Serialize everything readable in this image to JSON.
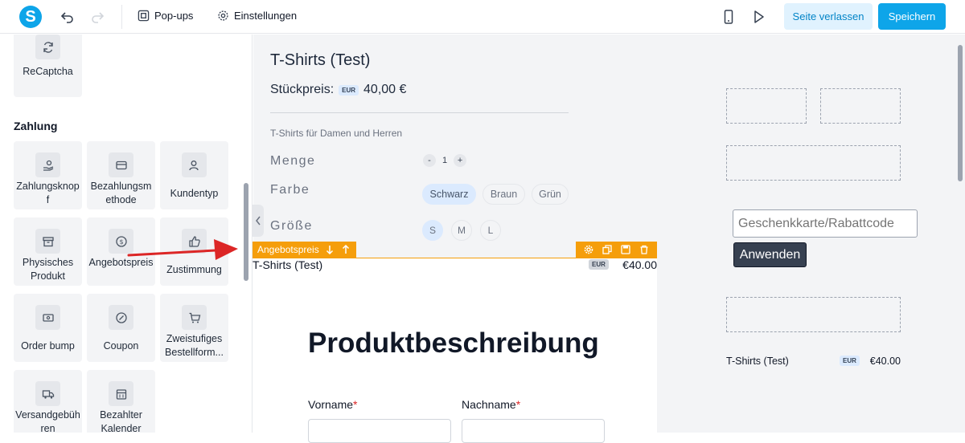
{
  "topbar": {
    "logo_letter": "S",
    "popups_label": "Pop-ups",
    "settings_label": "Einstellungen",
    "leave_label": "Seite verlassen",
    "save_label": "Speichern"
  },
  "sidebar": {
    "recaptcha_label": "ReCaptcha",
    "section_title": "Zahlung",
    "tiles": {
      "t1": "Zahlungsknopf",
      "t2": "Bezahlungsmethode",
      "t3": "Kundentyp",
      "t4": "Physisches Produkt",
      "t5": "Angebotspreis",
      "t6": "Zustimmung",
      "t7": "Order bump",
      "t8": "Coupon",
      "t9": "Zweistufiges Bestellform...",
      "t10": "Versandgebühren",
      "t11": "Bezahlter Kalender"
    }
  },
  "product": {
    "title": "T-Shirts (Test)",
    "price_label": "Stückpreis:",
    "currency_badge": "EUR",
    "price": "40,00 €",
    "description": "T-Shirts für Damen und Herren",
    "qty_label": "Menge",
    "qty_minus": "-",
    "qty_value": "1",
    "qty_plus": "+",
    "color_label": "Farbe",
    "colors": [
      "Schwarz",
      "Braun",
      "Grün"
    ],
    "size_label": "Größe",
    "sizes": [
      "S",
      "M",
      "L"
    ]
  },
  "selected_element": {
    "label": "Angebotspreis",
    "name": "T-Shirts (Test)",
    "currency_badge": "EUR",
    "price": "€40.00"
  },
  "form": {
    "heading": "Produktbeschreibung",
    "firstname_label": "Vorname",
    "lastname_label": "Nachname",
    "required_mark": "*"
  },
  "right_panel": {
    "coupon_placeholder": "Geschenkkarte/Rabattcode",
    "apply_label": "Anwenden",
    "summary_name": "T-Shirts (Test)",
    "summary_badge": "EUR",
    "summary_price": "€40.00"
  },
  "colors": {
    "accent": "#0ea5e9",
    "selection": "#f59e0b",
    "arrow": "#dc2626"
  }
}
